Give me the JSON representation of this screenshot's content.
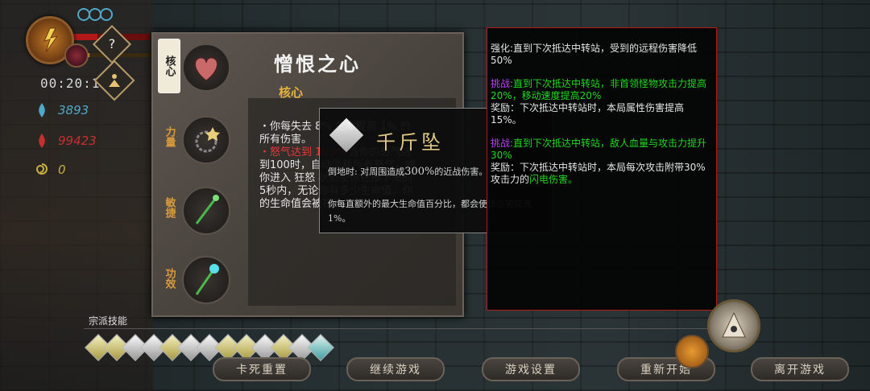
{
  "hud": {
    "timer": "00:20:1",
    "help_label": "?",
    "resources": [
      {
        "icon": "soul-flame-icon",
        "value": "3893",
        "color": "#4fa8c8"
      },
      {
        "icon": "blood-flame-icon",
        "value": "99423",
        "color": "#c43030"
      },
      {
        "icon": "spiral-coin-icon",
        "value": "0",
        "color": "#c8b040"
      }
    ],
    "hp_fraction": 0.35,
    "xp_fraction": 0.2
  },
  "panel": {
    "tabs": [
      {
        "label": "核心",
        "state": "active"
      },
      {
        "label": "力量",
        "state": "inactive"
      },
      {
        "label": "敏捷",
        "state": "inactive"
      },
      {
        "label": "功效",
        "state": "inactive"
      }
    ],
    "skill_title": "憎恨之心",
    "skill_type": "核心",
    "desc": {
      "p1": "・你每失去 8% 生命提高 1% 的所有伤害。",
      "p2_red": "・怒气达到 100%",
      "p2": " 当你的怒气达到100时，自动消耗所有怒气，使你进入 狂怒 状态使你在接下来的5秒内，无论你有多少生命值，你的生命值会被视为1点。"
    }
  },
  "tooltip": {
    "title": "千斤坠",
    "line1_prefix": "倒地时: 对周围造成",
    "line1_value": "300%",
    "line1_suffix": "的近战伤害。",
    "line2": "你每直额外的最大生命值百分比，都会使该伤害提高1%。"
  },
  "right_box": {
    "entries": [
      {
        "color": "c-white",
        "text": "强化:直到下次抵达中转站，受到的远程伤害降低50%"
      },
      {
        "color": "c-green",
        "prefix": "挑战",
        "text": ":直到下次抵达中转站，非首领怪物攻击力提高20%，移动速度提高20%"
      },
      {
        "color": "c-white",
        "text": "奖励：下次抵达中转站时，本局属性伤害提高15%。"
      },
      {
        "color": "c-green",
        "prefix": "挑战",
        "text": ":直到下次抵达中转站，敌人血量与攻击力提升30%"
      },
      {
        "color": "c-white",
        "prefix_white": "奖励：下次抵达中转站时，本局每次攻击附带30%攻击力的",
        "text_green": "闪电伤害。"
      }
    ]
  },
  "bottom": {
    "section_label": "宗派技能",
    "buttons": [
      "卡死重置",
      "继续游戏",
      "游戏设置",
      "重新开始",
      "离开游戏"
    ]
  }
}
